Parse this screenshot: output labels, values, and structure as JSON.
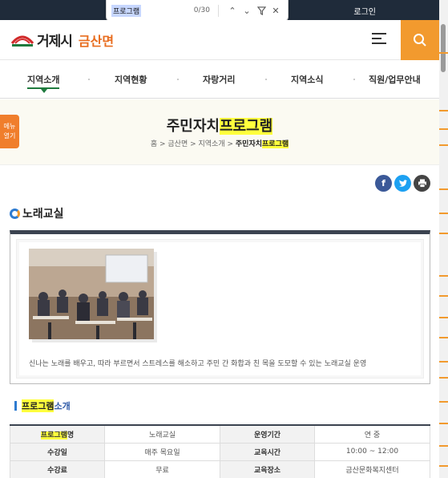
{
  "find_bar": {
    "query": "프로그램",
    "count": "0/30"
  },
  "top": {
    "login": "로그인"
  },
  "logo": {
    "city": "거제시",
    "sub": "금산면"
  },
  "gnb": [
    "지역소개",
    "지역현황",
    "자랑거리",
    "지역소식",
    "직원/업무안내"
  ],
  "hero": {
    "title_prefix": "주민자치",
    "title_hl": "프로그램",
    "crumb": [
      "홈",
      "금산면",
      "지역소개"
    ],
    "crumb_last_prefix": "주민자치",
    "crumb_last_hl": "프로그램"
  },
  "menu_tab": "메뉴 열기",
  "section": {
    "title": "노래교실",
    "description": "신나는 노래를 배우고, 따라 부르면서 스트레스를 해소하고 주민 간 화합과 친 목을 도모할 수 있는 노래교실 운영"
  },
  "intro": {
    "hl": "프로그램",
    "rest": "소개"
  },
  "table": {
    "rows": [
      {
        "h1_hl": "프로그램",
        "h1_rest": "명",
        "v1": "노래교실",
        "h2": "운영기간",
        "v2": "연 중"
      },
      {
        "h1_hl": "",
        "h1_rest": "수강일",
        "v1": "매주 목요일",
        "h2": "교육시간",
        "v2": "10:00 ~ 12:00"
      },
      {
        "h1_hl": "",
        "h1_rest": "수강료",
        "v1": "무료",
        "h2": "교육장소",
        "v2": "금산문화복지센터"
      }
    ]
  },
  "colors": {
    "accent": "#f29a2e",
    "nav_active": "#1e7a3d",
    "highlight": "#ffff3d"
  }
}
